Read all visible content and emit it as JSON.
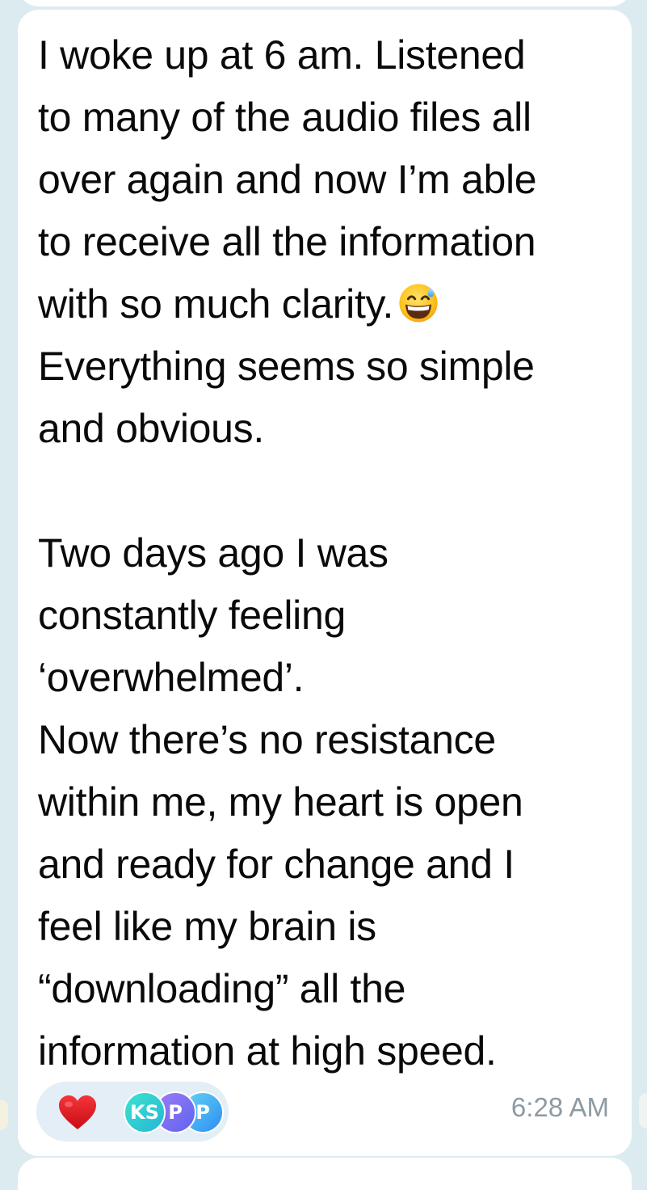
{
  "message": {
    "lines": [
      "I woke up at 6 am. Listened",
      "to many of the audio files all",
      "over again and now I’m able",
      "to receive all the information",
      "with so much clarity.",
      "Everything seems so simple",
      "and obvious.",
      "",
      "Two days ago I was",
      "constantly feeling",
      "‘overwhelmed’.",
      "Now there’s no resistance",
      "within me, my heart is open",
      "and ready for change and I",
      "feel like my brain is",
      "“downloading” all the",
      "information at high speed."
    ],
    "emoji": "grinning-face-with-sweat-icon",
    "timestamp": "6:28 AM"
  },
  "reactions": {
    "emoji": "red-heart-icon",
    "avatars": [
      {
        "initials": "KS",
        "color": "#2bc8d4"
      },
      {
        "initials": "P",
        "color": "#7a6cf2"
      },
      {
        "initials": "P",
        "color": "#3fa3f3"
      }
    ]
  },
  "colors": {
    "background": "#dcebf0",
    "bubble": "#ffffff",
    "text": "#0a0a0a",
    "timestamp": "#8e9aa2",
    "reaction_pill": "#e3eef6",
    "heart": "#e0161b"
  }
}
